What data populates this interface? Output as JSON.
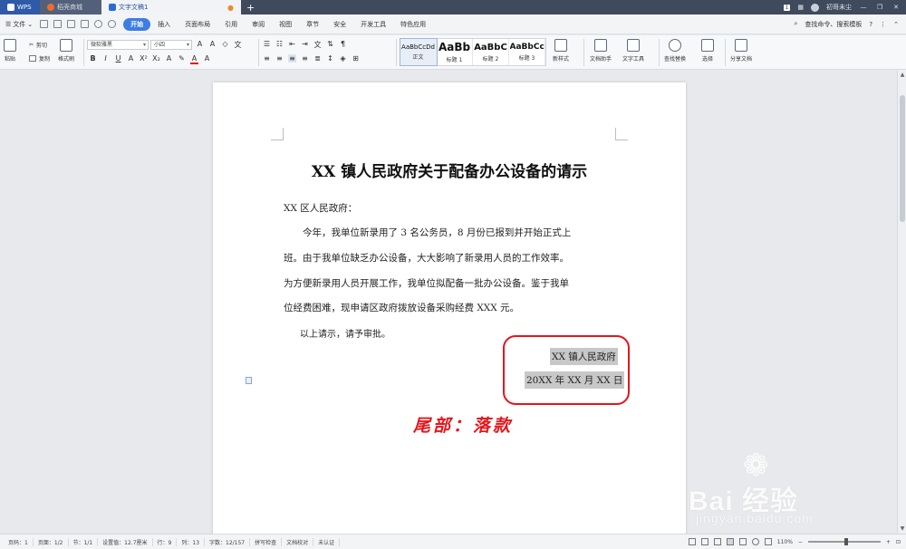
{
  "titlebar": {
    "tabs": [
      {
        "label": "WPS"
      },
      {
        "label": "稻壳商城"
      },
      {
        "label": "文字文稿1"
      }
    ],
    "page_badge": "1",
    "user": "初哥未尘",
    "window": {
      "min": "—",
      "restore": "❐",
      "close": "✕"
    }
  },
  "menubar": {
    "file": "文件",
    "items": [
      "开始",
      "插入",
      "页面布局",
      "引用",
      "审阅",
      "视图",
      "章节",
      "安全",
      "开发工具",
      "特色应用"
    ],
    "active": "开始",
    "search": "查找命令、搜索模板",
    "help": "?"
  },
  "ribbon": {
    "paste": "粘贴",
    "cut": "剪切",
    "copy": "复制",
    "format_painter": "格式刷",
    "font_name": "微软雅黑",
    "font_size": "小四",
    "styles": [
      {
        "preview": "AaBbCcDd",
        "label": "正文"
      },
      {
        "preview": "AaBb",
        "label": "标题 1"
      },
      {
        "preview": "AaBbC",
        "label": "标题 2"
      },
      {
        "preview": "AaBbCc",
        "label": "标题 3"
      }
    ],
    "new_style": "新样式",
    "doc_helper": "文档助手",
    "text_tools": "文字工具",
    "find_replace": "查找替换",
    "select": "选择",
    "share": "分享文档"
  },
  "document": {
    "title": "XX 镇人民政府关于配备办公设备的请示",
    "recipient": "XX 区人民政府：",
    "body_lines": [
      "今年，我单位新录用了 3 名公务员，8 月份已报到并开始正式上",
      "班。由于我单位缺乏办公设备，大大影响了新录用人员的工作效率。",
      "为方便新录用人员开展工作，我单位拟配备一批办公设备。鉴于我单",
      "位经费困难，现申请区政府拨放设备采购经费 XXX 元。"
    ],
    "closing": "以上请示，请予审批。",
    "signature_org": "XX 镇人民政府",
    "signature_date": "20XX 年 XX 月 XX 日",
    "annotation": "尾部：落款"
  },
  "watermark": {
    "brand": "Bai 经验",
    "url": "jingyan.baidu.com"
  },
  "statusbar": {
    "page_num": "页码：1",
    "page": "页面：1/2",
    "section": "节：1/1",
    "setting": "设置值：12.7厘米",
    "row": "行：9",
    "col": "列：13",
    "words": "字数：12/157",
    "spell": "拼写检查",
    "proof": "文档校对",
    "cert": "未认证",
    "zoom": "110%"
  },
  "colors": {
    "accent": "#3d7de4",
    "annotation_red": "#e3161c",
    "titlebar": "#3f4a5c"
  }
}
